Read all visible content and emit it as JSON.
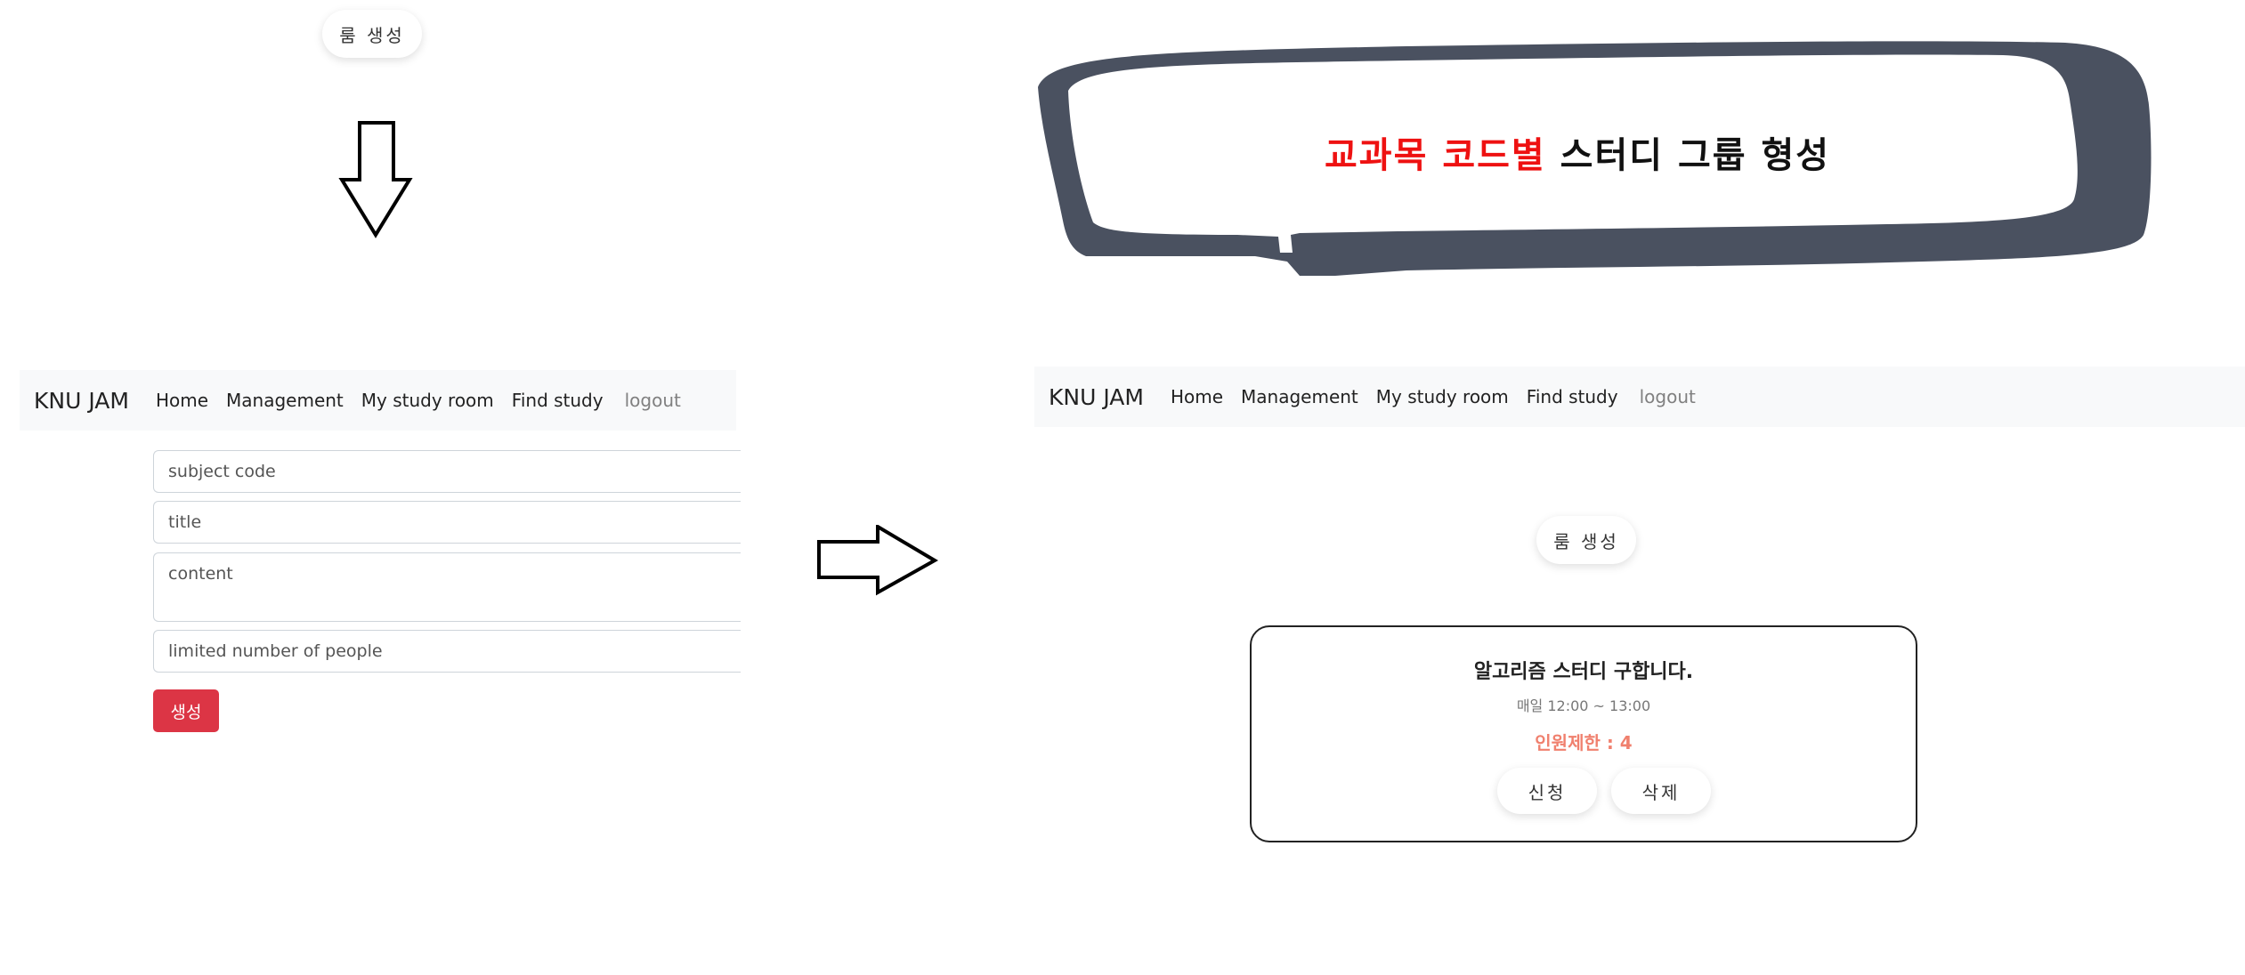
{
  "top_left": {
    "create_room_button": "룸 생성"
  },
  "callout": {
    "highlight_text": "교과목 코드별",
    "rest_text": " 스터디 그룹 형성",
    "highlight_color": "#ee1111",
    "bubble_color": "#4a5160"
  },
  "navbar_left": {
    "brand": "KNU JAM",
    "links": [
      "Home",
      "Management",
      "My study room",
      "Find study",
      "logout"
    ]
  },
  "form": {
    "subject_code_placeholder": "subject code",
    "title_placeholder": "title",
    "content_placeholder": "content",
    "limit_placeholder": "limited number of people",
    "submit_label": "생성",
    "submit_color": "#dc3545"
  },
  "navbar_right": {
    "brand": "KNU JAM",
    "links": [
      "Home",
      "Management",
      "My study room",
      "Find study",
      "logout"
    ]
  },
  "right_panel": {
    "create_room_button": "룸 생성"
  },
  "study_card": {
    "title": "알고리즘 스터디 구합니다.",
    "time": "매일 12:00 ~ 13:00",
    "limit": "인원제한 : 4",
    "apply_button": "신청",
    "delete_button": "삭제"
  },
  "icons": [
    "arrow-down-icon",
    "arrow-right-icon",
    "speech-bubble-icon"
  ]
}
